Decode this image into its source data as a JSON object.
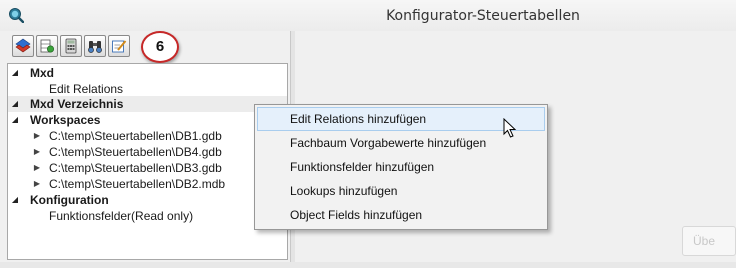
{
  "window": {
    "title": "Konfigurator-Steuertabellen",
    "app_icon": "magnifier-globe-icon"
  },
  "toolbar": {
    "buttons": [
      {
        "name": "layers-icon",
        "tooltip": ""
      },
      {
        "name": "table-settings-icon",
        "tooltip": ""
      },
      {
        "name": "calculator-icon",
        "tooltip": ""
      },
      {
        "name": "binoculars-icon",
        "tooltip": ""
      },
      {
        "name": "edit-form-icon",
        "tooltip": ""
      }
    ],
    "step_badge": "6"
  },
  "tree": {
    "nodes": [
      {
        "label": "Mxd",
        "level": 0,
        "expanded": true,
        "bold": true
      },
      {
        "label": "Edit Relations",
        "level": 1,
        "expanded": null,
        "bold": false
      },
      {
        "label": "Mxd Verzeichnis",
        "level": 0,
        "expanded": true,
        "bold": true,
        "highlighted": true
      },
      {
        "label": "Workspaces",
        "level": 0,
        "expanded": true,
        "bold": true
      },
      {
        "label": "C:\\temp\\Steuertabellen\\DB1.gdb",
        "level": 1,
        "expanded": false,
        "bold": false
      },
      {
        "label": "C:\\temp\\Steuertabellen\\DB4.gdb",
        "level": 1,
        "expanded": false,
        "bold": false
      },
      {
        "label": "C:\\temp\\Steuertabellen\\DB3.gdb",
        "level": 1,
        "expanded": false,
        "bold": false
      },
      {
        "label": "C:\\temp\\Steuertabellen\\DB2.mdb",
        "level": 1,
        "expanded": false,
        "bold": false
      },
      {
        "label": "Konfiguration",
        "level": 0,
        "expanded": true,
        "bold": true
      },
      {
        "label": "Funktionsfelder(Read only)",
        "level": 1,
        "expanded": null,
        "bold": false
      }
    ]
  },
  "context_menu": {
    "items": [
      {
        "label": "Edit Relations hinzufügen",
        "hovered": true
      },
      {
        "label": "Fachbaum Vorgabewerte hinzufügen",
        "hovered": false
      },
      {
        "label": "Funktionsfelder hinzufügen",
        "hovered": false
      },
      {
        "label": "Lookups hinzufügen",
        "hovered": false
      },
      {
        "label": "Object Fields hinzufügen",
        "hovered": false
      }
    ]
  },
  "right_panel": {
    "ghost_button_label": "Übe"
  },
  "colors": {
    "badge_border": "#c62828",
    "menu_hover_bg": "#e5f0fb",
    "menu_hover_border": "#a9cdee"
  }
}
